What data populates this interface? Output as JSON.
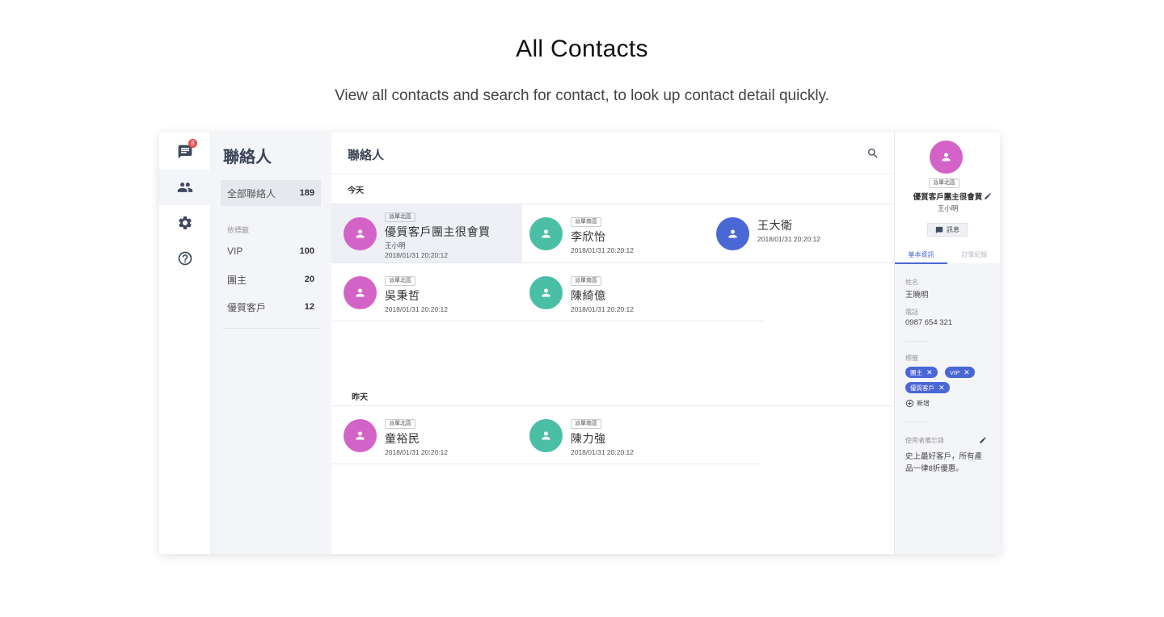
{
  "hero": {
    "title": "All Contacts",
    "subtitle": "View all contacts and search for contact, to look up contact detail quickly."
  },
  "rail": {
    "badge_count": "8",
    "items": [
      {
        "icon": "chat-icon"
      },
      {
        "icon": "contacts-icon",
        "active": true
      },
      {
        "icon": "gear-icon"
      },
      {
        "icon": "help-icon"
      }
    ]
  },
  "filter": {
    "title": "聯絡人",
    "all": {
      "label": "全部聯絡人",
      "count": "189"
    },
    "caption": "依標籤",
    "tags": [
      {
        "label": "VIP",
        "count": "100"
      },
      {
        "label": "團主",
        "count": "20"
      },
      {
        "label": "優質客戶",
        "count": "12"
      }
    ]
  },
  "main": {
    "title": "聯絡人",
    "sections": {
      "today": "今天",
      "yesterday": "昨天"
    },
    "today_cards": [
      {
        "tag": "派單北區",
        "name": "優質客戶團主很會買",
        "sub": "王小明",
        "time": "2018/01/31 20:20:12",
        "color": "#d463c7",
        "selected": true
      },
      {
        "tag": "派單南區",
        "name": "李欣怡",
        "time": "2018/01/31 20:20:12",
        "color": "#4bbfa6"
      },
      {
        "tag": "",
        "name": "王大衛",
        "time": "2018/01/31 20:20:12",
        "color": "#4a67d6"
      },
      {
        "tag": "派單北區",
        "name": "吳秉哲",
        "time": "2018/01/31 20:20:12",
        "color": "#d463c7"
      },
      {
        "tag": "派單南區",
        "name": "陳綺億",
        "time": "2018/01/31 20:20:12",
        "color": "#4bbfa6"
      }
    ],
    "yesterday_cards": [
      {
        "tag": "派單北區",
        "name": "童裕民",
        "time": "2018/01/31 20:20:12",
        "color": "#d463c7"
      },
      {
        "tag": "派單南區",
        "name": "陳力強",
        "time": "2018/01/31 20:20:12",
        "color": "#4bbfa6"
      }
    ]
  },
  "detail": {
    "tag": "派單北區",
    "name": "優質客戶團主很會買",
    "sub": "王小明",
    "message_button": "訊息",
    "tabs": [
      "基本資訊",
      "訂單紀錄"
    ],
    "name_label": "姓名",
    "name_value": "王曉明",
    "phone_label": "電話",
    "phone_value": "0987 654 321",
    "tags_label": "標籤",
    "tags": [
      "團主",
      "VIP",
      "優質客戶"
    ],
    "add_label": "新增",
    "memo_label": "使用者備忘錄",
    "memo_lines": [
      "史上最好客戶，所有產",
      "品一律8折優惠。"
    ]
  },
  "colors": {
    "accent": "#4a67d6",
    "pink": "#d463c7",
    "teal": "#4bbfa6",
    "badge": "#e84b4b"
  }
}
